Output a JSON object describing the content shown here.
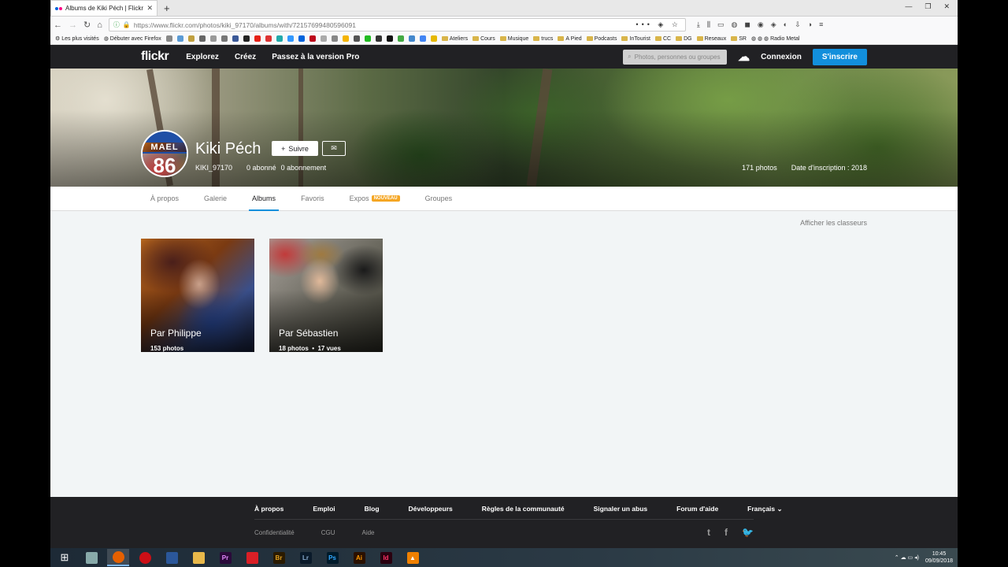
{
  "browser": {
    "tab_title": "Albums de Kiki Péch | Flickr",
    "url": "https://www.flickr.com/photos/kiki_97170/albums/with/72157699480596091",
    "bookmarks": [
      "Les plus visités",
      "Débuter avec Firefox",
      "Ateliers",
      "Cours",
      "Musique",
      "trucs",
      "A Pied",
      "Podcasts",
      "InTourist",
      "CC",
      "DG",
      "Reseaux",
      "SR",
      "Radio Metal"
    ]
  },
  "header": {
    "logo": "flickr",
    "nav": [
      "Explorez",
      "Créez",
      "Passez à la version Pro"
    ],
    "search_placeholder": "Photos, personnes ou groupes",
    "login": "Connexion",
    "signup": "S'inscrire"
  },
  "profile": {
    "avatar_line1": "MAEL",
    "avatar_line2": "86",
    "name": "Kiki Péch",
    "follow": "Suivre",
    "username": "KIKI_97170",
    "followers": "0 abonné",
    "following": "0 abonnement",
    "photos": "171 photos",
    "joined": "Date d'inscription : 2018"
  },
  "subnav": {
    "items": [
      "À propos",
      "Galerie",
      "Albums",
      "Favoris",
      "Expos",
      "Groupes"
    ],
    "active": "Albums",
    "badge": "NOUVEAU"
  },
  "content": {
    "show_sets": "Afficher les classeurs",
    "albums": [
      {
        "title": "Par Philippe",
        "stats": "153 photos"
      },
      {
        "title": "Par Sébastien",
        "stats": "18 photos  •  17 vues"
      }
    ]
  },
  "footer": {
    "links": [
      "À propos",
      "Emploi",
      "Blog",
      "Développeurs",
      "Règles de la communauté",
      "Signaler un abus",
      "Forum d'aide",
      "Français ⌄"
    ],
    "secondary": [
      "Confidentialité",
      "CGU",
      "Aide"
    ]
  },
  "taskbar": {
    "time": "10:45",
    "date": "09/09/2018"
  }
}
